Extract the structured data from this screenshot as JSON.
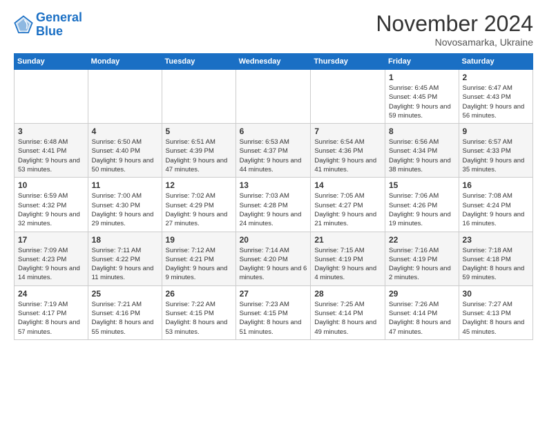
{
  "logo": {
    "line1": "General",
    "line2": "Blue"
  },
  "title": "November 2024",
  "location": "Novosamarka, Ukraine",
  "weekdays": [
    "Sunday",
    "Monday",
    "Tuesday",
    "Wednesday",
    "Thursday",
    "Friday",
    "Saturday"
  ],
  "rows": [
    [
      {
        "day": "",
        "info": ""
      },
      {
        "day": "",
        "info": ""
      },
      {
        "day": "",
        "info": ""
      },
      {
        "day": "",
        "info": ""
      },
      {
        "day": "",
        "info": ""
      },
      {
        "day": "1",
        "info": "Sunrise: 6:45 AM\nSunset: 4:45 PM\nDaylight: 9 hours and 59 minutes."
      },
      {
        "day": "2",
        "info": "Sunrise: 6:47 AM\nSunset: 4:43 PM\nDaylight: 9 hours and 56 minutes."
      }
    ],
    [
      {
        "day": "3",
        "info": "Sunrise: 6:48 AM\nSunset: 4:41 PM\nDaylight: 9 hours and 53 minutes."
      },
      {
        "day": "4",
        "info": "Sunrise: 6:50 AM\nSunset: 4:40 PM\nDaylight: 9 hours and 50 minutes."
      },
      {
        "day": "5",
        "info": "Sunrise: 6:51 AM\nSunset: 4:39 PM\nDaylight: 9 hours and 47 minutes."
      },
      {
        "day": "6",
        "info": "Sunrise: 6:53 AM\nSunset: 4:37 PM\nDaylight: 9 hours and 44 minutes."
      },
      {
        "day": "7",
        "info": "Sunrise: 6:54 AM\nSunset: 4:36 PM\nDaylight: 9 hours and 41 minutes."
      },
      {
        "day": "8",
        "info": "Sunrise: 6:56 AM\nSunset: 4:34 PM\nDaylight: 9 hours and 38 minutes."
      },
      {
        "day": "9",
        "info": "Sunrise: 6:57 AM\nSunset: 4:33 PM\nDaylight: 9 hours and 35 minutes."
      }
    ],
    [
      {
        "day": "10",
        "info": "Sunrise: 6:59 AM\nSunset: 4:32 PM\nDaylight: 9 hours and 32 minutes."
      },
      {
        "day": "11",
        "info": "Sunrise: 7:00 AM\nSunset: 4:30 PM\nDaylight: 9 hours and 29 minutes."
      },
      {
        "day": "12",
        "info": "Sunrise: 7:02 AM\nSunset: 4:29 PM\nDaylight: 9 hours and 27 minutes."
      },
      {
        "day": "13",
        "info": "Sunrise: 7:03 AM\nSunset: 4:28 PM\nDaylight: 9 hours and 24 minutes."
      },
      {
        "day": "14",
        "info": "Sunrise: 7:05 AM\nSunset: 4:27 PM\nDaylight: 9 hours and 21 minutes."
      },
      {
        "day": "15",
        "info": "Sunrise: 7:06 AM\nSunset: 4:26 PM\nDaylight: 9 hours and 19 minutes."
      },
      {
        "day": "16",
        "info": "Sunrise: 7:08 AM\nSunset: 4:24 PM\nDaylight: 9 hours and 16 minutes."
      }
    ],
    [
      {
        "day": "17",
        "info": "Sunrise: 7:09 AM\nSunset: 4:23 PM\nDaylight: 9 hours and 14 minutes."
      },
      {
        "day": "18",
        "info": "Sunrise: 7:11 AM\nSunset: 4:22 PM\nDaylight: 9 hours and 11 minutes."
      },
      {
        "day": "19",
        "info": "Sunrise: 7:12 AM\nSunset: 4:21 PM\nDaylight: 9 hours and 9 minutes."
      },
      {
        "day": "20",
        "info": "Sunrise: 7:14 AM\nSunset: 4:20 PM\nDaylight: 9 hours and 6 minutes."
      },
      {
        "day": "21",
        "info": "Sunrise: 7:15 AM\nSunset: 4:19 PM\nDaylight: 9 hours and 4 minutes."
      },
      {
        "day": "22",
        "info": "Sunrise: 7:16 AM\nSunset: 4:19 PM\nDaylight: 9 hours and 2 minutes."
      },
      {
        "day": "23",
        "info": "Sunrise: 7:18 AM\nSunset: 4:18 PM\nDaylight: 8 hours and 59 minutes."
      }
    ],
    [
      {
        "day": "24",
        "info": "Sunrise: 7:19 AM\nSunset: 4:17 PM\nDaylight: 8 hours and 57 minutes."
      },
      {
        "day": "25",
        "info": "Sunrise: 7:21 AM\nSunset: 4:16 PM\nDaylight: 8 hours and 55 minutes."
      },
      {
        "day": "26",
        "info": "Sunrise: 7:22 AM\nSunset: 4:15 PM\nDaylight: 8 hours and 53 minutes."
      },
      {
        "day": "27",
        "info": "Sunrise: 7:23 AM\nSunset: 4:15 PM\nDaylight: 8 hours and 51 minutes."
      },
      {
        "day": "28",
        "info": "Sunrise: 7:25 AM\nSunset: 4:14 PM\nDaylight: 8 hours and 49 minutes."
      },
      {
        "day": "29",
        "info": "Sunrise: 7:26 AM\nSunset: 4:14 PM\nDaylight: 8 hours and 47 minutes."
      },
      {
        "day": "30",
        "info": "Sunrise: 7:27 AM\nSunset: 4:13 PM\nDaylight: 8 hours and 45 minutes."
      }
    ]
  ]
}
